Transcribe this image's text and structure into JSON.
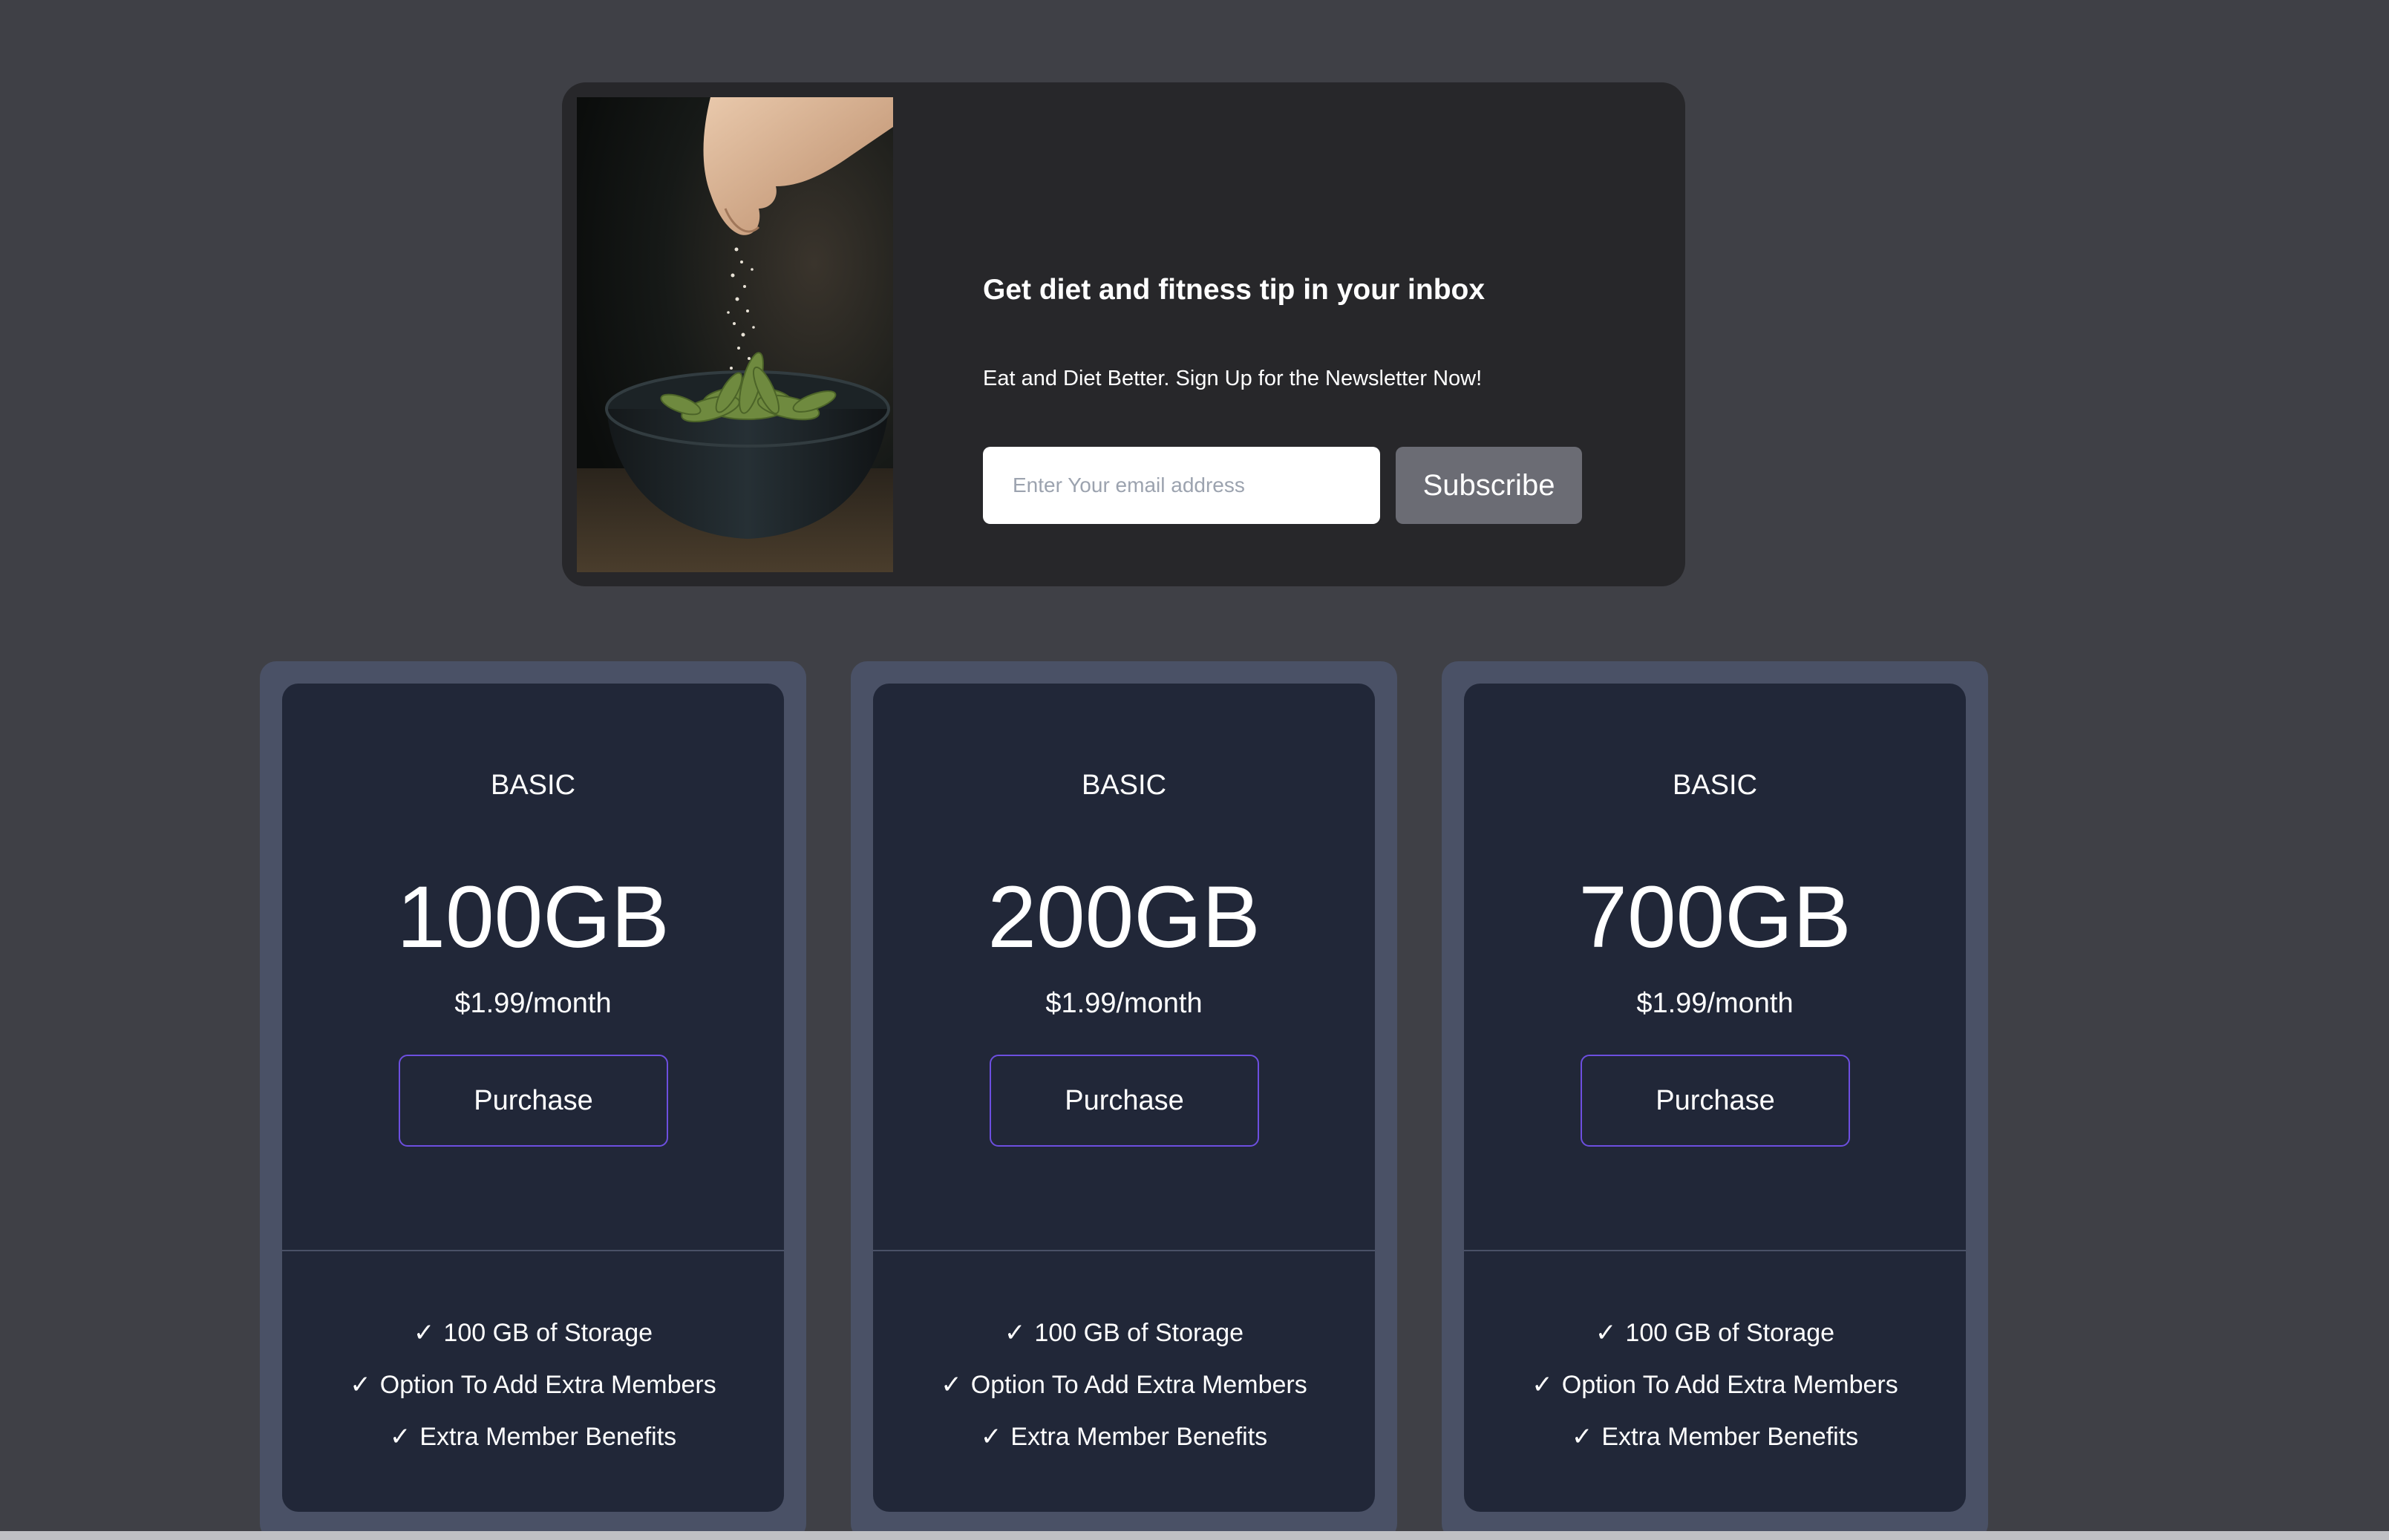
{
  "newsletter": {
    "image_subject": "hand sprinkling salt over a bowl of edamame",
    "title": "Get diet and fitness tip in your inbox",
    "subtitle": "Eat and Diet Better. Sign Up for the Newsletter Now!",
    "email_placeholder": "Enter Your email address",
    "email_value": "",
    "subscribe_label": "Subscribe"
  },
  "plans": [
    {
      "tier": "BASIC",
      "size": "100GB",
      "price": "$1.99/month",
      "purchase_label": "Purchase",
      "features": [
        "100 GB of Storage",
        "Option To Add Extra Members",
        "Extra Member Benefits"
      ]
    },
    {
      "tier": "BASIC",
      "size": "200GB",
      "price": "$1.99/month",
      "purchase_label": "Purchase",
      "features": [
        "100 GB of Storage",
        "Option To Add Extra Members",
        "Extra Member Benefits"
      ]
    },
    {
      "tier": "BASIC",
      "size": "700GB",
      "price": "$1.99/month",
      "purchase_label": "Purchase",
      "features": [
        "100 GB of Storage",
        "Option To Add Extra Members",
        "Extra Member Benefits"
      ]
    }
  ],
  "icons": {
    "check": "check-icon"
  },
  "colors": {
    "page_background": "#3f4046",
    "newsletter_background": "#27272a",
    "subscribe_button": "#6b6c74",
    "plan_frame": "#4a5166",
    "plan_background": "#212738",
    "purchase_border": "#6d4fe0"
  }
}
